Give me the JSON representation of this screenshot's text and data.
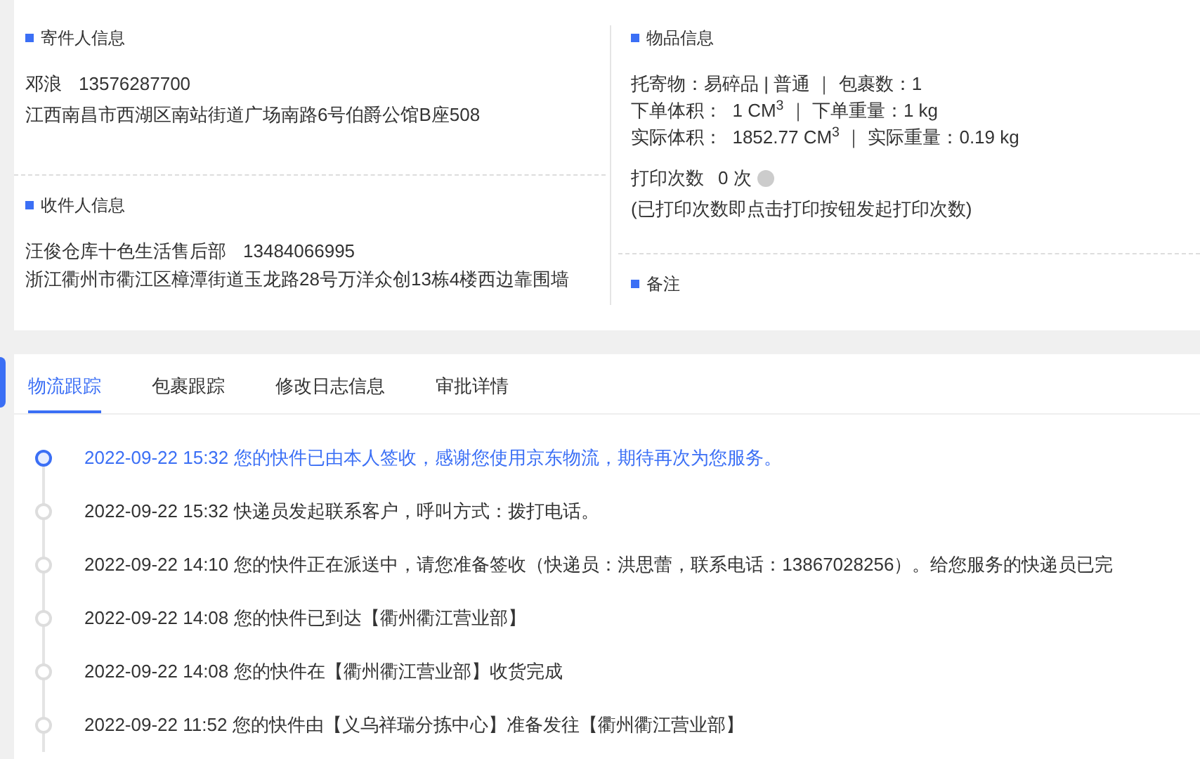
{
  "sender": {
    "title": "寄件人信息",
    "name": "邓浪",
    "phone": "13576287700",
    "address": "江西南昌市西湖区南站街道广场南路6号伯爵公馆B座508"
  },
  "receiver": {
    "title": "收件人信息",
    "name": "汪俊仓库十色生活售后部",
    "phone": "13484066995",
    "address": "浙江衢州市衢江区樟潭街道玉龙路28号万洋众创13栋4楼西边靠围墙"
  },
  "item": {
    "title": "物品信息",
    "lines": [
      "托寄物：易碎品 | 普通 ｜ 包裹数：1",
      "下单体积：  1 CM$^{3}$ ｜ 下单重量：1 kg",
      "实际体积：  1852.77 CM$^{3}$ ｜ 实际重量：0.19 kg"
    ],
    "print_label": "打印次数",
    "print_count": "0 次",
    "print_note": "(已打印次数即点击打印按钮发起打印次数)"
  },
  "remark": {
    "title": "备注"
  },
  "tabs": [
    {
      "label": "物流跟踪",
      "selected": true
    },
    {
      "label": "包裹跟踪",
      "selected": false
    },
    {
      "label": "修改日志信息",
      "selected": false
    },
    {
      "label": "审批详情",
      "selected": false
    }
  ],
  "timeline": [
    {
      "time": "2022-09-22 15:32",
      "text": "您的快件已由本人签收，感谢您使用京东物流，期待再次为您服务。",
      "current": true
    },
    {
      "time": "2022-09-22 15:32",
      "text": "快递员发起联系客户，呼叫方式：拨打电话。",
      "current": false
    },
    {
      "time": "2022-09-22 14:10",
      "text": "您的快件正在派送中，请您准备签收（快递员：洪思蕾，联系电话：13867028256）。给您服务的快递员已完",
      "current": false
    },
    {
      "time": "2022-09-22 14:08",
      "text": "您的快件已到达【衢州衢江营业部】",
      "current": false
    },
    {
      "time": "2022-09-22 14:08",
      "text": "您的快件在【衢州衢江营业部】收货完成",
      "current": false
    },
    {
      "time": "2022-09-22 11:52",
      "text": "您的快件由【义乌祥瑞分拣中心】准备发往【衢州衢江营业部】",
      "current": false
    }
  ]
}
